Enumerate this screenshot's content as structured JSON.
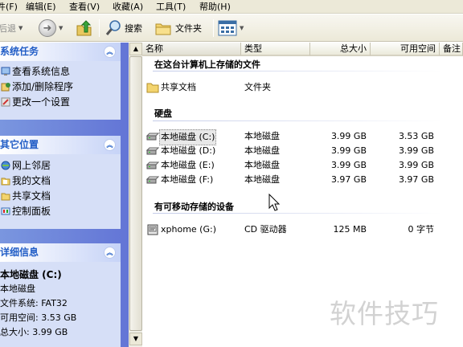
{
  "menu": [
    {
      "label": "件(F)"
    },
    {
      "label": "编辑(E)"
    },
    {
      "label": "查看(V)"
    },
    {
      "label": "收藏(A)"
    },
    {
      "label": "工具(T)"
    },
    {
      "label": "帮助(H)"
    }
  ],
  "toolbar": {
    "back_label": "后退",
    "search_label": "搜索",
    "folders_label": "文件夹"
  },
  "left_panel": {
    "system_tasks": {
      "title": "系统任务",
      "items": [
        {
          "label": "查看系统信息"
        },
        {
          "label": "添加/删除程序"
        },
        {
          "label": "更改一个设置"
        }
      ]
    },
    "other_places": {
      "title": "其它位置",
      "items": [
        {
          "label": "网上邻居"
        },
        {
          "label": "我的文档"
        },
        {
          "label": "共享文档"
        },
        {
          "label": "控制面板"
        }
      ]
    },
    "details": {
      "title": "详细信息",
      "name": "本地磁盘 (C:)",
      "type": "本地磁盘",
      "fs": "文件系统: FAT32",
      "free": "可用空间: 3.53 GB",
      "total": "总大小: 3.99 GB"
    }
  },
  "columns": [
    "名称",
    "类型",
    "总大小",
    "可用空间",
    "备注"
  ],
  "groups": {
    "stored": "在这台计算机上存储的文件",
    "hdd": "硬盘",
    "removable": "有可移动存储的设备"
  },
  "rows": {
    "shared": {
      "name": "共享文档",
      "type": "文件夹"
    },
    "drives": [
      {
        "name": "本地磁盘 (C:)",
        "type": "本地磁盘",
        "total": "3.99 GB",
        "free": "3.53 GB"
      },
      {
        "name": "本地磁盘 (D:)",
        "type": "本地磁盘",
        "total": "3.99 GB",
        "free": "3.99 GB"
      },
      {
        "name": "本地磁盘 (E:)",
        "type": "本地磁盘",
        "total": "3.99 GB",
        "free": "3.99 GB"
      },
      {
        "name": "本地磁盘 (F:)",
        "type": "本地磁盘",
        "total": "3.97 GB",
        "free": "3.97 GB"
      }
    ],
    "cd": {
      "name": "xphome (G:)",
      "type": "CD 驱动器",
      "total": "125 MB",
      "free": "0 字节"
    }
  },
  "watermark": "软件技巧"
}
